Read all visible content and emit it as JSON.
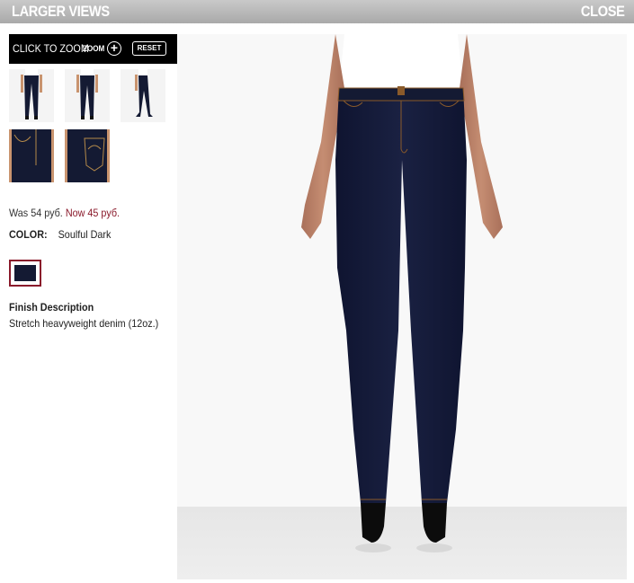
{
  "header": {
    "title": "LARGER VIEWS",
    "close_label": "CLOSE"
  },
  "zoom_bar": {
    "click_to_zoom": "CLICK TO ZOOM",
    "zoom_label": "ZOOM",
    "zoom_plus": "+",
    "reset_label": "RESET"
  },
  "thumbnails": [
    {
      "view": "front"
    },
    {
      "view": "back"
    },
    {
      "view": "side"
    },
    {
      "view": "front-detail"
    },
    {
      "view": "back-pocket-detail"
    }
  ],
  "price": {
    "was": "Was 54 руб.",
    "now": "Now 45 руб."
  },
  "color": {
    "label": "COLOR:",
    "value": "Soulful Dark",
    "swatch_color": "#141a33"
  },
  "finish": {
    "title": "Finish Description",
    "description": "Stretch heavyweight denim (12oz.)"
  },
  "colors": {
    "header_bg": "#b5b5b5",
    "accent": "#8a1a2b",
    "denim": "#141a33"
  }
}
